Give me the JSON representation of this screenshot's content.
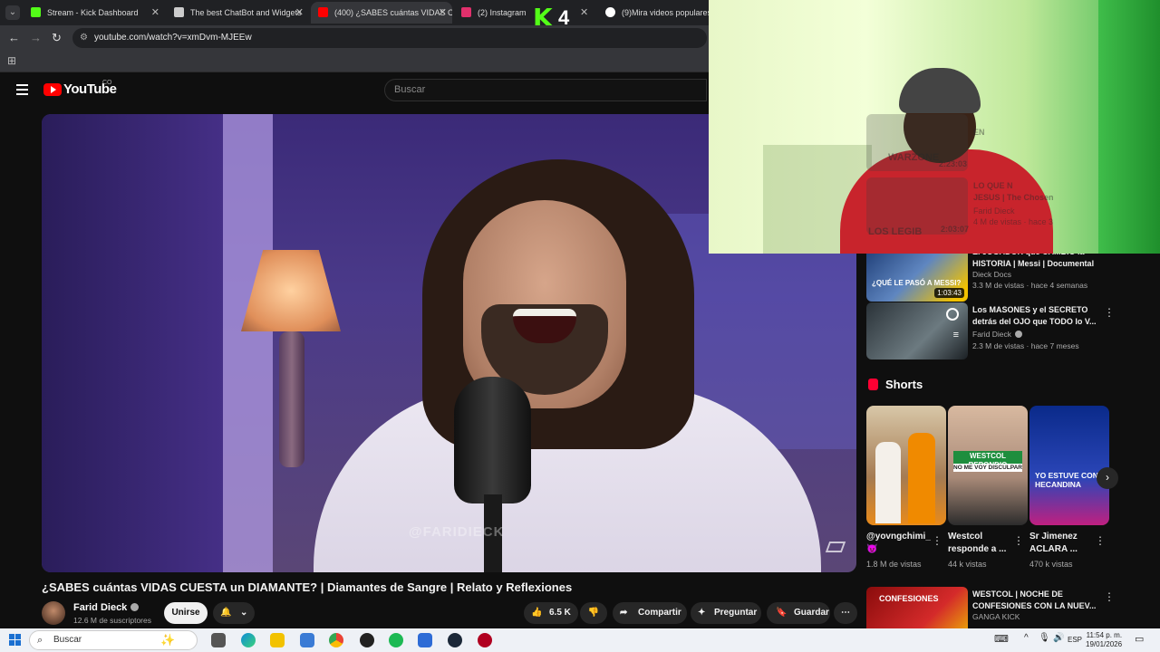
{
  "browser": {
    "tabs": [
      {
        "title": "Stream - Kick Dashboard",
        "active": false,
        "favicon_color": "#53fc18"
      },
      {
        "title": "The best ChatBot and Widgets",
        "active": false,
        "favicon_color": "#cccccc"
      },
      {
        "title": "(400) ¿SABES cuántas VIDAS CU",
        "active": true,
        "favicon_color": "#ff0000"
      },
      {
        "title": "(2) Instagram",
        "active": false,
        "favicon_color": "#e1306c"
      },
      {
        "title": "(9)Mira videos populares sel",
        "active": false,
        "favicon_color": "#ffffff"
      }
    ],
    "url": "youtube.com/watch?v=xmDvm-MJEEw"
  },
  "kick_overlay": {
    "letter": "K",
    "number": "4"
  },
  "youtube": {
    "logo_text": "YouTube",
    "country_code": "CO",
    "search_placeholder": "Buscar"
  },
  "video": {
    "title": "¿SABES cuántas VIDAS CUESTA un DIAMANTE? | Diamantes de Sangre | Relato y Reflexiones",
    "watermark": "@FARIDIECK",
    "channel": "Farid Dieck",
    "subscribers": "12.6 M de suscriptores",
    "join_label": "Unirse",
    "likes": "6.5 K",
    "share_label": "Compartir",
    "ask_label": "Preguntar",
    "save_label": "Guardar"
  },
  "sidebar": {
    "items": [
      {
        "title": "El JUGADOR que CAMBIÓ la HISTORIA | Messi | Documental",
        "channel": "Dieck Docs",
        "meta": "3.3 M de vistas · hace 4 semanas",
        "duration": "1:03:43",
        "thumb_text": "¿QUÉ LE PASÓ A MESSI?"
      },
      {
        "title": "Los MASONES y el SECRETO detrás del OJO que TODO lo V...",
        "channel": "Farid Dieck",
        "meta": "2.3 M de vistas · hace 7 meses",
        "duration": ""
      },
      {
        "title": "WESTCOL | NOCHE DE CONFESIONES CON LA NUEV...",
        "channel": "GANGA KICK",
        "meta": "",
        "duration": "",
        "thumb_text": "CONFESIONES"
      }
    ],
    "shorts_heading": "Shorts",
    "shorts": [
      {
        "title": "@yovngchimi_ 😈",
        "views": "1.8 M de vistas"
      },
      {
        "title": "Westcol responde a ...",
        "views": "44 k vistas",
        "thumb_text": "WESTCOL REPONDIO",
        "thumb_sub": "NO ME VOY DISCULPAR"
      },
      {
        "title": "Sr Jimenez ACLARA ...",
        "views": "470 k vistas",
        "thumb_text": "YO ESTUVE CON HECANDINA"
      }
    ]
  },
  "cam_ghost": {
    "texts": [
      "2:23:03",
      "WARZONE",
      "LO QUE N",
      "JESUS | The Chosen",
      "Farid Dieck",
      "4 M de vistas · hace 3",
      "LOS LEGIB",
      "2:03:07",
      "EN"
    ]
  },
  "taskbar": {
    "search_label": "Buscar",
    "lang": "ESP",
    "time": "11:54 p. m.",
    "date": "19/01/2026"
  }
}
